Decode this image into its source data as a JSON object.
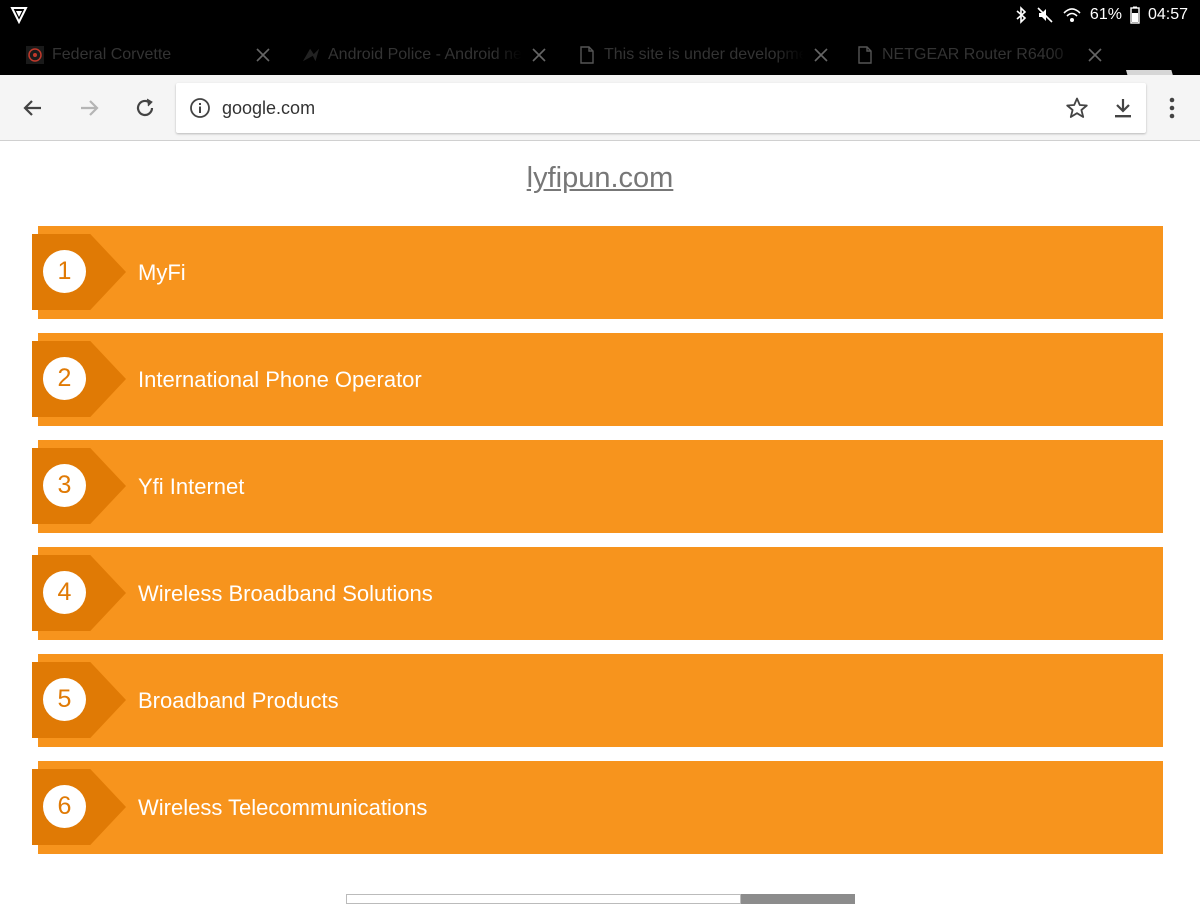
{
  "status_bar": {
    "battery": "61%",
    "time": "04:57"
  },
  "tabs": [
    {
      "title": "Federal Corvette",
      "favicon": "corvette-favicon"
    },
    {
      "title": "Android Police - Android news",
      "favicon": "android-police-favicon"
    },
    {
      "title": "This site is under development",
      "favicon": "page-icon",
      "active": true
    },
    {
      "title": "NETGEAR Router R6400",
      "favicon": "page-icon"
    }
  ],
  "toolbar": {
    "url": "google.com"
  },
  "page": {
    "site_title": "lyfipun.com",
    "items": [
      {
        "number": "1",
        "label": "MyFi"
      },
      {
        "number": "2",
        "label": "International Phone Operator"
      },
      {
        "number": "3",
        "label": "Yfi Internet"
      },
      {
        "number": "4",
        "label": "Wireless Broadband Solutions"
      },
      {
        "number": "5",
        "label": "Broadband Products"
      },
      {
        "number": "6",
        "label": "Wireless Telecommunications"
      }
    ]
  },
  "colors": {
    "row_orange": "#f7941d",
    "badge_orange": "#e07a05"
  }
}
